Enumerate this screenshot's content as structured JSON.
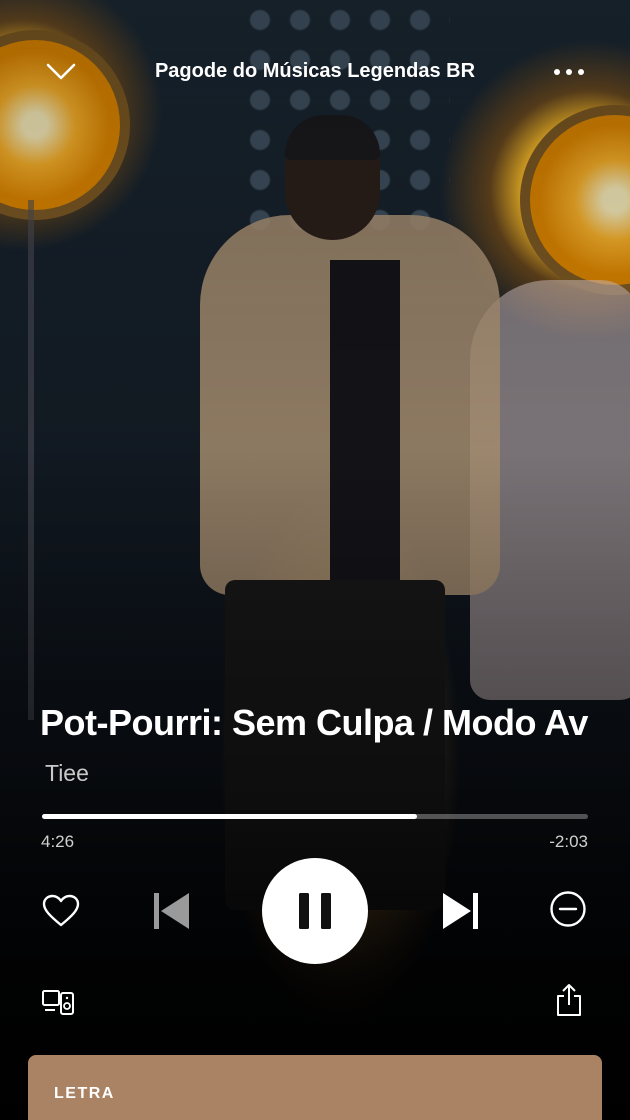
{
  "header": {
    "title": "Pagode do Músicas Legendas BR",
    "collapse_icon": "chevron-down-icon",
    "menu_icon": "more-options-icon"
  },
  "track": {
    "title": "Pot-Pourri: Sem Culpa / Modo Av",
    "artist": "Tiee"
  },
  "playback": {
    "elapsed": "4:26",
    "remaining": "-2:03",
    "progress": 0.687,
    "state": "playing"
  },
  "controls": {
    "like_icon": "heart-icon",
    "previous_icon": "skip-previous-icon",
    "pause_icon": "pause-icon",
    "next_icon": "skip-next-icon",
    "hide_icon": "minus-circle-icon",
    "devices_icon": "connect-devices-icon",
    "share_icon": "share-icon"
  },
  "lyrics": {
    "label": "LETRA",
    "card_color": "#a98363"
  }
}
